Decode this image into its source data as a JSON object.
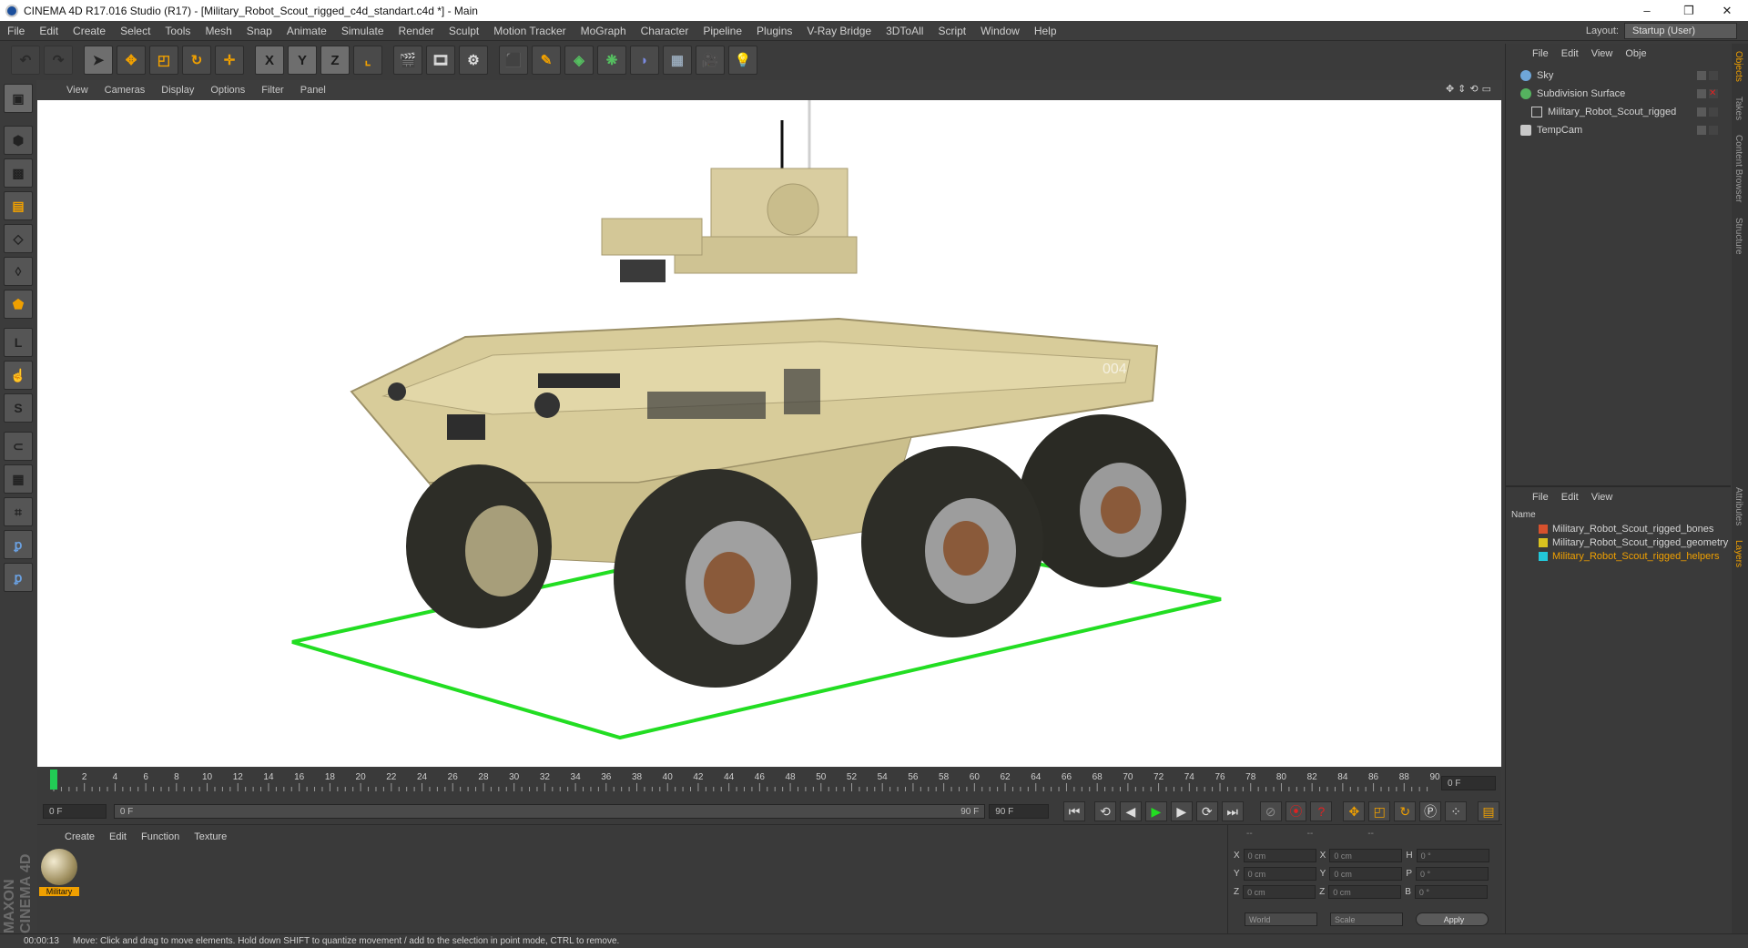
{
  "window": {
    "title": "CINEMA 4D R17.016 Studio (R17) - [Military_Robot_Scout_rigged_c4d_standart.c4d *] - Main",
    "min": "–",
    "max": "❐",
    "close": "✕"
  },
  "menu": [
    "File",
    "Edit",
    "Create",
    "Select",
    "Tools",
    "Mesh",
    "Snap",
    "Animate",
    "Simulate",
    "Render",
    "Sculpt",
    "Motion Tracker",
    "MoGraph",
    "Character",
    "Pipeline",
    "Plugins",
    "V-Ray Bridge",
    "3DToAll",
    "Script",
    "Window",
    "Help"
  ],
  "layout": {
    "label": "Layout:",
    "value": "Startup (User)"
  },
  "toolbar": {
    "x": "X",
    "y": "Y",
    "z": "Z"
  },
  "viewport_menu": [
    "View",
    "Cameras",
    "Display",
    "Options",
    "Filter",
    "Panel"
  ],
  "viewport_scene": {
    "vehicle_marking": "004"
  },
  "timeline": {
    "ticks": [
      "0",
      "2",
      "4",
      "6",
      "8",
      "10",
      "12",
      "14",
      "16",
      "18",
      "20",
      "22",
      "24",
      "26",
      "28",
      "30",
      "32",
      "34",
      "36",
      "38",
      "40",
      "42",
      "44",
      "46",
      "48",
      "50",
      "52",
      "54",
      "56",
      "58",
      "60",
      "62",
      "64",
      "66",
      "68",
      "70",
      "72",
      "74",
      "76",
      "78",
      "80",
      "82",
      "84",
      "86",
      "88",
      "90"
    ],
    "current_frame": "0 F",
    "start": "0 F",
    "range_start": "0 F",
    "range_end": "90 F",
    "end": "90 F",
    "playhead_fraction": 0
  },
  "material_menu": [
    "Create",
    "Edit",
    "Function",
    "Texture"
  ],
  "material": {
    "name": "Military"
  },
  "coords": {
    "header": [
      "--",
      "--",
      "--"
    ],
    "rows": [
      {
        "a": "X",
        "av": "0 cm",
        "b": "X",
        "bv": "0 cm",
        "c": "H",
        "cv": "0 °"
      },
      {
        "a": "Y",
        "av": "0 cm",
        "b": "Y",
        "bv": "0 cm",
        "c": "P",
        "cv": "0 °"
      },
      {
        "a": "Z",
        "av": "0 cm",
        "b": "Z",
        "bv": "0 cm",
        "c": "B",
        "cv": "0 °"
      }
    ],
    "world": "World",
    "scale": "Scale",
    "apply": "Apply"
  },
  "objects_menu": [
    "File",
    "Edit",
    "View",
    "Obje"
  ],
  "objects": [
    {
      "name": "Sky",
      "icon_color": "#6fa6d8"
    },
    {
      "name": "Subdivision Surface",
      "icon_color": "#55b35f"
    },
    {
      "name": "Military_Robot_Scout_rigged",
      "icon_color": "#c8c8c8"
    },
    {
      "name": "TempCam",
      "icon_color": "#c8c8c8"
    }
  ],
  "layers_menu": [
    "File",
    "Edit",
    "View"
  ],
  "layers_header": "Name",
  "layers": [
    {
      "name": "Military_Robot_Scout_rigged_bones",
      "color": "#d7512d",
      "text_color": "#d4d4d4"
    },
    {
      "name": "Military_Robot_Scout_rigged_geometry",
      "color": "#d9c21f",
      "text_color": "#d4d4d4"
    },
    {
      "name": "Military_Robot_Scout_rigged_helpers",
      "color": "#23c7d9",
      "text_color": "#f0a000"
    }
  ],
  "side_tabs": [
    "Objects",
    "Takes",
    "Content Browser",
    "Structure",
    "Attributes",
    "Layers"
  ],
  "status": {
    "time": "00:00:13",
    "message": "Move: Click and drag to move elements. Hold down SHIFT to quantize movement / add to the selection in point mode, CTRL to remove."
  },
  "maxon": "MAXON CINEMA 4D",
  "colors": {
    "accent": "#f0a000",
    "viewport_bg": "#ffffff",
    "ground_outline": "#22dd22",
    "vehicle": "#d8cc9a"
  }
}
